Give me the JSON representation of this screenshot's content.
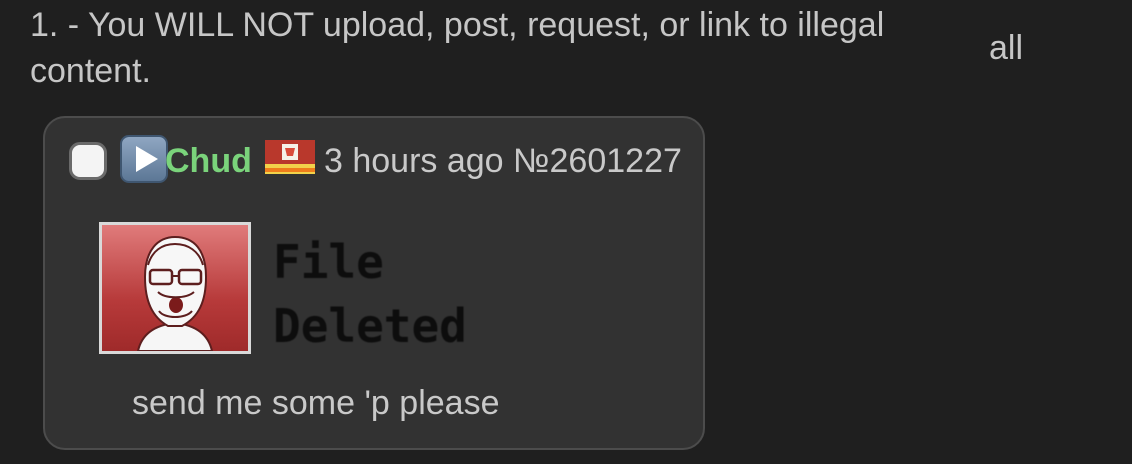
{
  "rule": {
    "text": "1. - You WILL NOT upload, post, request, or link to illegal content."
  },
  "aside": {
    "text": "all"
  },
  "post": {
    "name": "Chud",
    "time": "3 hours ago",
    "number": "№2601227",
    "file_status": "File Deleted",
    "message": "send me some 'p please"
  },
  "icons": {
    "select": "checkbox-icon",
    "expand": "play-expand-icon",
    "flag": "flag-icon",
    "thumbnail": "deleted-file-thumbnail"
  },
  "colors": {
    "background": "#1f1f1f",
    "post_background": "#323232",
    "post_border": "#4c4c4c",
    "name": "#7ad37b",
    "text": "#c9c9c9"
  }
}
